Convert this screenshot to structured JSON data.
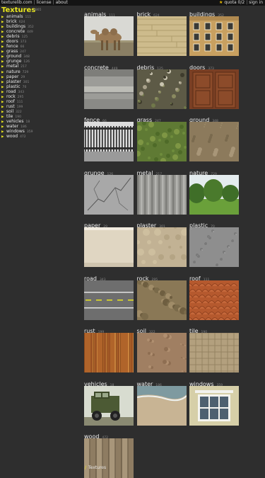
{
  "topbar": {
    "links": [
      "texturelib.com",
      "license",
      "about"
    ],
    "quota": "quota 0/2",
    "signin": "sign in"
  },
  "sidebar": {
    "title": "Textures",
    "count": "6865",
    "items": [
      {
        "name": "animals",
        "count": "111"
      },
      {
        "name": "brick",
        "count": "624"
      },
      {
        "name": "buildings",
        "count": "352"
      },
      {
        "name": "concrete",
        "count": "449"
      },
      {
        "name": "debris",
        "count": "125"
      },
      {
        "name": "doors",
        "count": "373"
      },
      {
        "name": "fence",
        "count": "66"
      },
      {
        "name": "grass",
        "count": "247"
      },
      {
        "name": "ground",
        "count": "348"
      },
      {
        "name": "grunge",
        "count": "126"
      },
      {
        "name": "metal",
        "count": "217"
      },
      {
        "name": "nature",
        "count": "729"
      },
      {
        "name": "paper",
        "count": "29"
      },
      {
        "name": "plaster",
        "count": "301"
      },
      {
        "name": "plastic",
        "count": "70"
      },
      {
        "name": "road",
        "count": "343"
      },
      {
        "name": "rock",
        "count": "295"
      },
      {
        "name": "roof",
        "count": "111"
      },
      {
        "name": "rust",
        "count": "199"
      },
      {
        "name": "soil",
        "count": "322"
      },
      {
        "name": "tile",
        "count": "190"
      },
      {
        "name": "vehicles",
        "count": "18"
      },
      {
        "name": "water",
        "count": "186"
      },
      {
        "name": "windows",
        "count": "359"
      },
      {
        "name": "wood",
        "count": "472"
      }
    ]
  },
  "grid": [
    {
      "name": "animals",
      "count": "111",
      "thumb": "camel"
    },
    {
      "name": "brick",
      "count": "624",
      "thumb": "sandstone-blocks"
    },
    {
      "name": "buildings",
      "count": "352",
      "thumb": "building-facade"
    },
    {
      "name": "concrete",
      "count": "449",
      "thumb": "concrete-slab"
    },
    {
      "name": "debris",
      "count": "125",
      "thumb": "debris-pile"
    },
    {
      "name": "doors",
      "count": "373",
      "thumb": "wooden-door"
    },
    {
      "name": "fence",
      "count": "66",
      "thumb": "metal-fence"
    },
    {
      "name": "grass",
      "count": "247",
      "thumb": "grass-field"
    },
    {
      "name": "ground",
      "count": "348",
      "thumb": "dirt-ground"
    },
    {
      "name": "grunge",
      "count": "126",
      "thumb": "cracked-surface"
    },
    {
      "name": "metal",
      "count": "217",
      "thumb": "corrugated-metal"
    },
    {
      "name": "nature",
      "count": "729",
      "thumb": "trees-meadow"
    },
    {
      "name": "paper",
      "count": "29",
      "thumb": "paper-sheet"
    },
    {
      "name": "plaster",
      "count": "301",
      "thumb": "plaster-wall"
    },
    {
      "name": "plastic",
      "count": "70",
      "thumb": "plastic-surface"
    },
    {
      "name": "road",
      "count": "343",
      "thumb": "asphalt-road"
    },
    {
      "name": "rock",
      "count": "295",
      "thumb": "rock-surface"
    },
    {
      "name": "roof",
      "count": "111",
      "thumb": "roof-tiles"
    },
    {
      "name": "rust",
      "count": "199",
      "thumb": "rusty-metal"
    },
    {
      "name": "soil",
      "count": "322",
      "thumb": "soil-ground"
    },
    {
      "name": "tile",
      "count": "190",
      "thumb": "floor-tiles"
    },
    {
      "name": "vehicles",
      "count": "18",
      "thumb": "military-truck"
    },
    {
      "name": "water",
      "count": "186",
      "thumb": "beach-shore"
    },
    {
      "name": "windows",
      "count": "359",
      "thumb": "house-window"
    },
    {
      "name": "wood",
      "count": "472",
      "thumb": "wood-planks"
    }
  ],
  "footer": {
    "slash": "/",
    "label": "Textures"
  },
  "colors": {
    "accent": "#e9e61e",
    "background": "#2e2e2e",
    "topbar": "#141414",
    "muted": "#888888"
  }
}
